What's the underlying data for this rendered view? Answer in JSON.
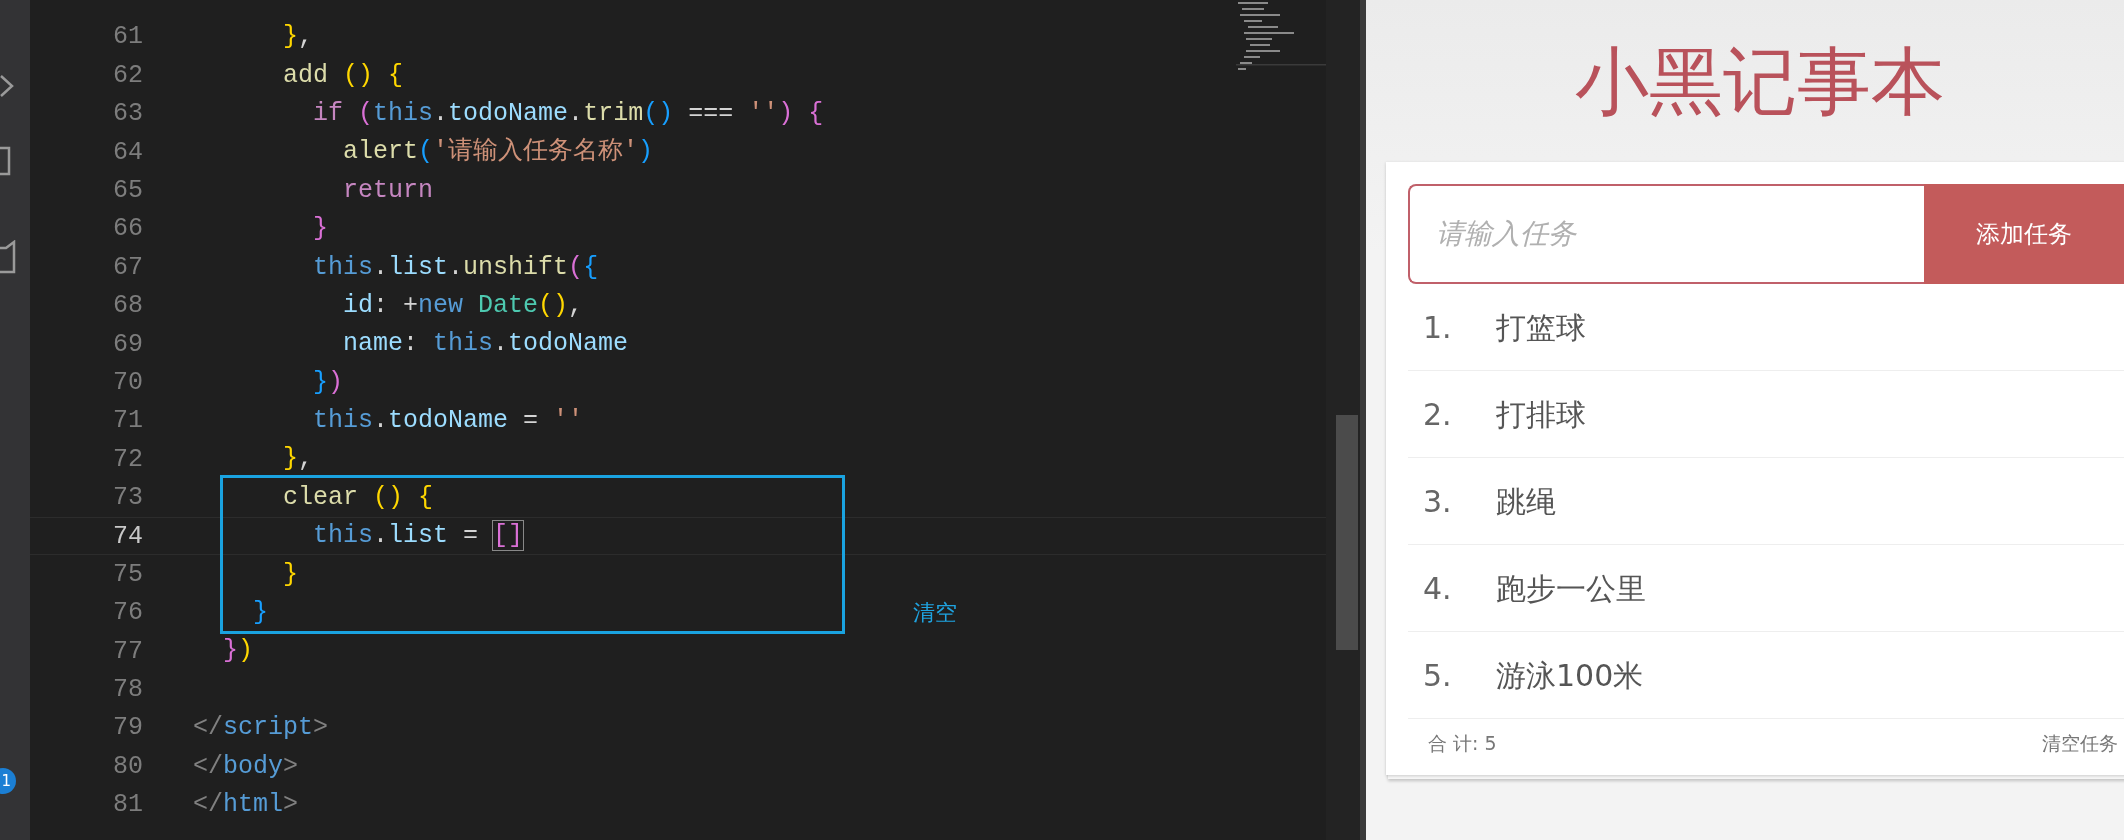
{
  "activity_bar": {
    "badge": "1"
  },
  "editor": {
    "lines": [
      {
        "number": "61",
        "current": false,
        "tokens": [
          {
            "t": "      }",
            "color": "#ffd700"
          },
          {
            "t": ",",
            "color": "#d4d4d4"
          }
        ]
      },
      {
        "number": "62",
        "current": false,
        "tokens": [
          {
            "t": "      add ",
            "color": "#dcdcaa"
          },
          {
            "t": "() {",
            "color": "#ffd700"
          }
        ]
      },
      {
        "number": "63",
        "current": false,
        "tokens": [
          {
            "t": "        if ",
            "color": "#c586c0"
          },
          {
            "t": "(",
            "color": "#da70d6"
          },
          {
            "t": "this",
            "color": "#569cd6"
          },
          {
            "t": ".",
            "color": "#d4d4d4"
          },
          {
            "t": "todoName",
            "color": "#9cdcfe"
          },
          {
            "t": ".",
            "color": "#d4d4d4"
          },
          {
            "t": "trim",
            "color": "#dcdcaa"
          },
          {
            "t": "()",
            "color": "#179fff"
          },
          {
            "t": " === ",
            "color": "#d4d4d4"
          },
          {
            "t": "''",
            "color": "#ce9178"
          },
          {
            "t": ") {",
            "color": "#da70d6"
          }
        ]
      },
      {
        "number": "64",
        "current": false,
        "tokens": [
          {
            "t": "          alert",
            "color": "#dcdcaa"
          },
          {
            "t": "(",
            "color": "#179fff"
          },
          {
            "t": "'请输入任务名称'",
            "color": "#ce9178"
          },
          {
            "t": ")",
            "color": "#179fff"
          }
        ]
      },
      {
        "number": "65",
        "current": false,
        "tokens": [
          {
            "t": "          return",
            "color": "#c586c0"
          }
        ]
      },
      {
        "number": "66",
        "current": false,
        "tokens": [
          {
            "t": "        }",
            "color": "#da70d6"
          }
        ]
      },
      {
        "number": "67",
        "current": false,
        "tokens": [
          {
            "t": "        this",
            "color": "#569cd6"
          },
          {
            "t": ".",
            "color": "#d4d4d4"
          },
          {
            "t": "list",
            "color": "#9cdcfe"
          },
          {
            "t": ".",
            "color": "#d4d4d4"
          },
          {
            "t": "unshift",
            "color": "#dcdcaa"
          },
          {
            "t": "(",
            "color": "#da70d6"
          },
          {
            "t": "{",
            "color": "#179fff"
          }
        ]
      },
      {
        "number": "68",
        "current": false,
        "tokens": [
          {
            "t": "          id",
            "color": "#9cdcfe"
          },
          {
            "t": ": +",
            "color": "#d4d4d4"
          },
          {
            "t": "new ",
            "color": "#569cd6"
          },
          {
            "t": "Date",
            "color": "#4ec9b0"
          },
          {
            "t": "()",
            "color": "#ffd700"
          },
          {
            "t": ",",
            "color": "#d4d4d4"
          }
        ]
      },
      {
        "number": "69",
        "current": false,
        "tokens": [
          {
            "t": "          name",
            "color": "#9cdcfe"
          },
          {
            "t": ": ",
            "color": "#d4d4d4"
          },
          {
            "t": "this",
            "color": "#569cd6"
          },
          {
            "t": ".",
            "color": "#d4d4d4"
          },
          {
            "t": "todoName",
            "color": "#9cdcfe"
          }
        ]
      },
      {
        "number": "70",
        "current": false,
        "tokens": [
          {
            "t": "        }",
            "color": "#179fff"
          },
          {
            "t": ")",
            "color": "#da70d6"
          }
        ]
      },
      {
        "number": "71",
        "current": false,
        "tokens": [
          {
            "t": "        this",
            "color": "#569cd6"
          },
          {
            "t": ".",
            "color": "#d4d4d4"
          },
          {
            "t": "todoName",
            "color": "#9cdcfe"
          },
          {
            "t": " = ",
            "color": "#d4d4d4"
          },
          {
            "t": "''",
            "color": "#ce9178"
          }
        ]
      },
      {
        "number": "72",
        "current": false,
        "tokens": [
          {
            "t": "      }",
            "color": "#ffd700"
          },
          {
            "t": ",",
            "color": "#d4d4d4"
          }
        ]
      },
      {
        "number": "73",
        "current": false,
        "tokens": [
          {
            "t": "      clear ",
            "color": "#dcdcaa"
          },
          {
            "t": "() {",
            "color": "#ffd700"
          }
        ]
      },
      {
        "number": "74",
        "current": true,
        "tokens": [
          {
            "t": "        this",
            "color": "#569cd6"
          },
          {
            "t": ".",
            "color": "#d4d4d4"
          },
          {
            "t": "list",
            "color": "#9cdcfe"
          },
          {
            "t": " = ",
            "color": "#d4d4d4"
          },
          {
            "t": "[]",
            "color": "#da70d6",
            "matched": true
          }
        ]
      },
      {
        "number": "75",
        "current": false,
        "tokens": [
          {
            "t": "      }",
            "color": "#ffd700"
          }
        ]
      },
      {
        "number": "76",
        "current": false,
        "tokens": [
          {
            "t": "    }",
            "color": "#179fff"
          }
        ]
      },
      {
        "number": "77",
        "current": false,
        "tokens": [
          {
            "t": "  }",
            "color": "#da70d6"
          },
          {
            "t": ")",
            "color": "#ffd700"
          }
        ]
      },
      {
        "number": "78",
        "current": false
      },
      {
        "number": "79",
        "current": false,
        "tokens": [
          {
            "t": "</",
            "color": "#808080"
          },
          {
            "t": "script",
            "color": "#569cd6"
          },
          {
            "t": ">",
            "color": "#808080"
          }
        ]
      },
      {
        "number": "80",
        "current": false,
        "tokens": [
          {
            "t": "</",
            "color": "#808080"
          },
          {
            "t": "body",
            "color": "#569cd6"
          },
          {
            "t": ">",
            "color": "#808080"
          }
        ]
      },
      {
        "number": "81",
        "current": false,
        "tokens": [
          {
            "t": "</",
            "color": "#808080"
          },
          {
            "t": "html",
            "color": "#569cd6"
          },
          {
            "t": ">",
            "color": "#808080"
          }
        ]
      }
    ]
  },
  "annotation": {
    "label": "清空"
  },
  "app": {
    "title": "小黑记事本",
    "input": {
      "placeholder": "请输入任务"
    },
    "add_button": "添加任务",
    "todos": [
      {
        "number": "1.",
        "name": "打篮球"
      },
      {
        "number": "2.",
        "name": "打排球"
      },
      {
        "number": "3.",
        "name": "跳绳"
      },
      {
        "number": "4.",
        "name": "跑步一公里"
      },
      {
        "number": "5.",
        "name": "游泳100米"
      }
    ],
    "footer": {
      "total": "合 计: 5",
      "clear_button": "清空任务"
    }
  }
}
